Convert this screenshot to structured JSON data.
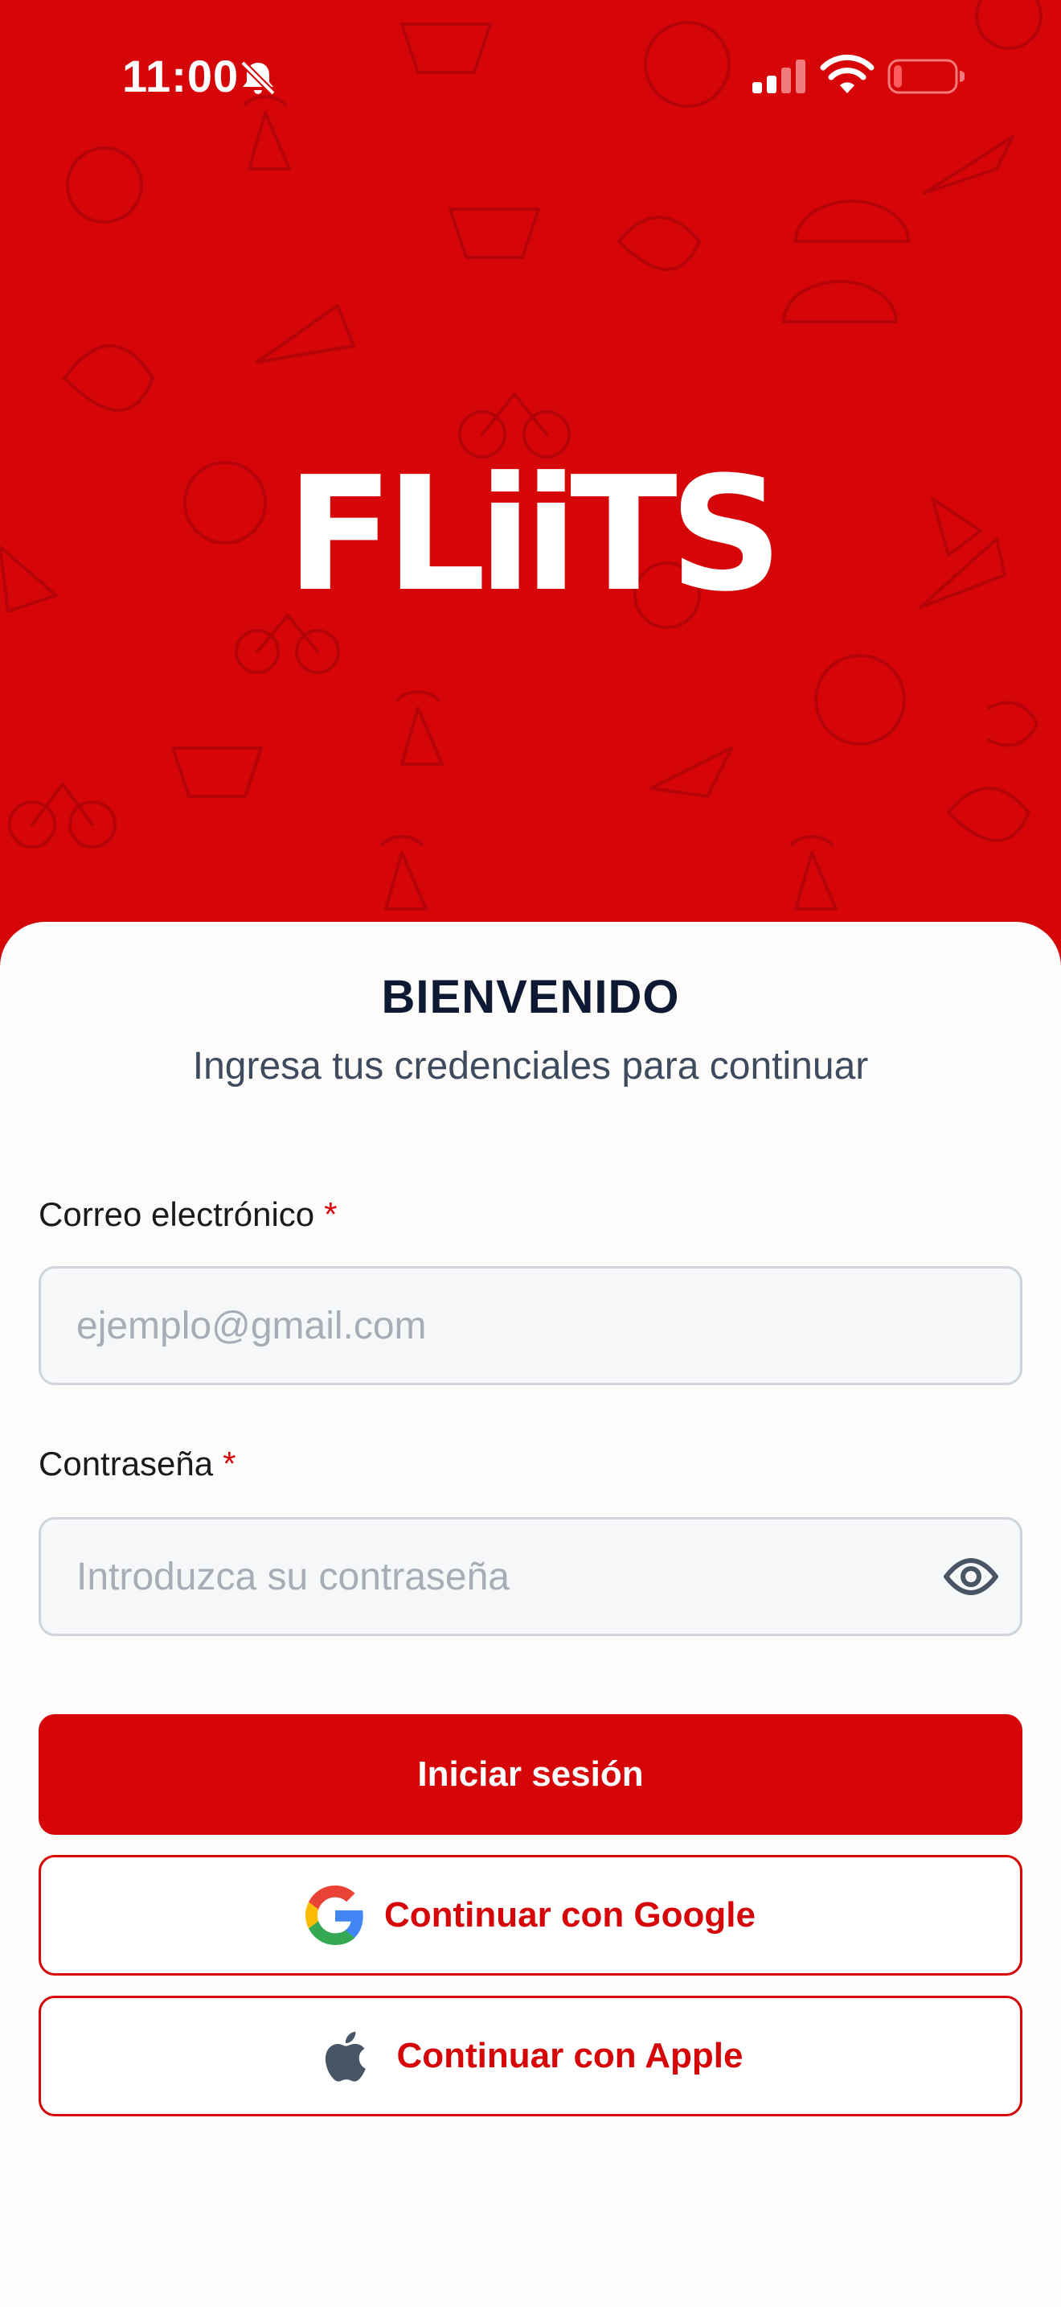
{
  "colors": {
    "brand_red": "#d50508",
    "sheet_background": "#fdfcfb",
    "title_navy": "#0e1a33",
    "apple_gray": "#485566"
  },
  "status_bar": {
    "time": "11:00",
    "icons": [
      "bell-slash-icon",
      "cellular-signal-icon",
      "wifi-icon",
      "battery-icon"
    ]
  },
  "header": {
    "logo_text": "FLiiTS"
  },
  "login": {
    "title": "BIENVENIDO",
    "subtitle": "Ingresa tus credenciales para continuar",
    "email": {
      "label": "Correo electrónico",
      "required_mark": "*",
      "value": "",
      "placeholder": "ejemplo@gmail.com"
    },
    "password": {
      "label": "Contraseña",
      "required_mark": "*",
      "value": "",
      "placeholder": "Introduzca su contraseña",
      "toggle_icon": "eye-icon"
    },
    "sign_in_label": "Iniciar sesión",
    "google_label": "Continuar con Google",
    "google_icon": "google-icon",
    "apple_label": "Continuar con Apple",
    "apple_icon": "apple-icon"
  }
}
